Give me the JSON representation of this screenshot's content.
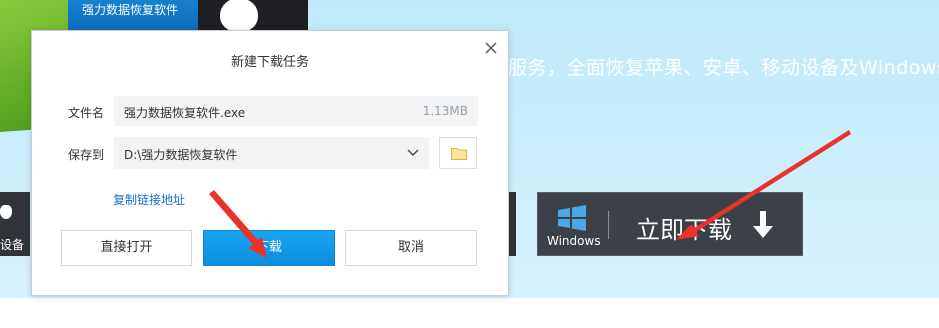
{
  "background": {
    "tagline": "服务，全面恢复苹果、安卓、移动设备及Windows数",
    "tile_text": "强力数据恢复软件",
    "left_device_label": "设备",
    "windows_label": "Windows",
    "download_now": "立即下载"
  },
  "dialog": {
    "title": "新建下载任务",
    "file_name_label": "文件名",
    "file_name_value": "强力数据恢复软件.exe",
    "file_size": "1.13MB",
    "save_to_label": "保存到",
    "save_path": "D:\\强力数据恢复软件",
    "copy_link": "复制链接地址",
    "open_button": "直接打开",
    "download_button": "下载",
    "cancel_button": "取消"
  },
  "colors": {
    "accent_blue": "#1296e6",
    "annotation_red": "#e8322a",
    "link_blue": "#1a73c9"
  },
  "icons": [
    "close-icon",
    "chevron-down-icon",
    "folder-icon",
    "windows-logo-icon",
    "download-arrow-icon",
    "apple-icon"
  ]
}
